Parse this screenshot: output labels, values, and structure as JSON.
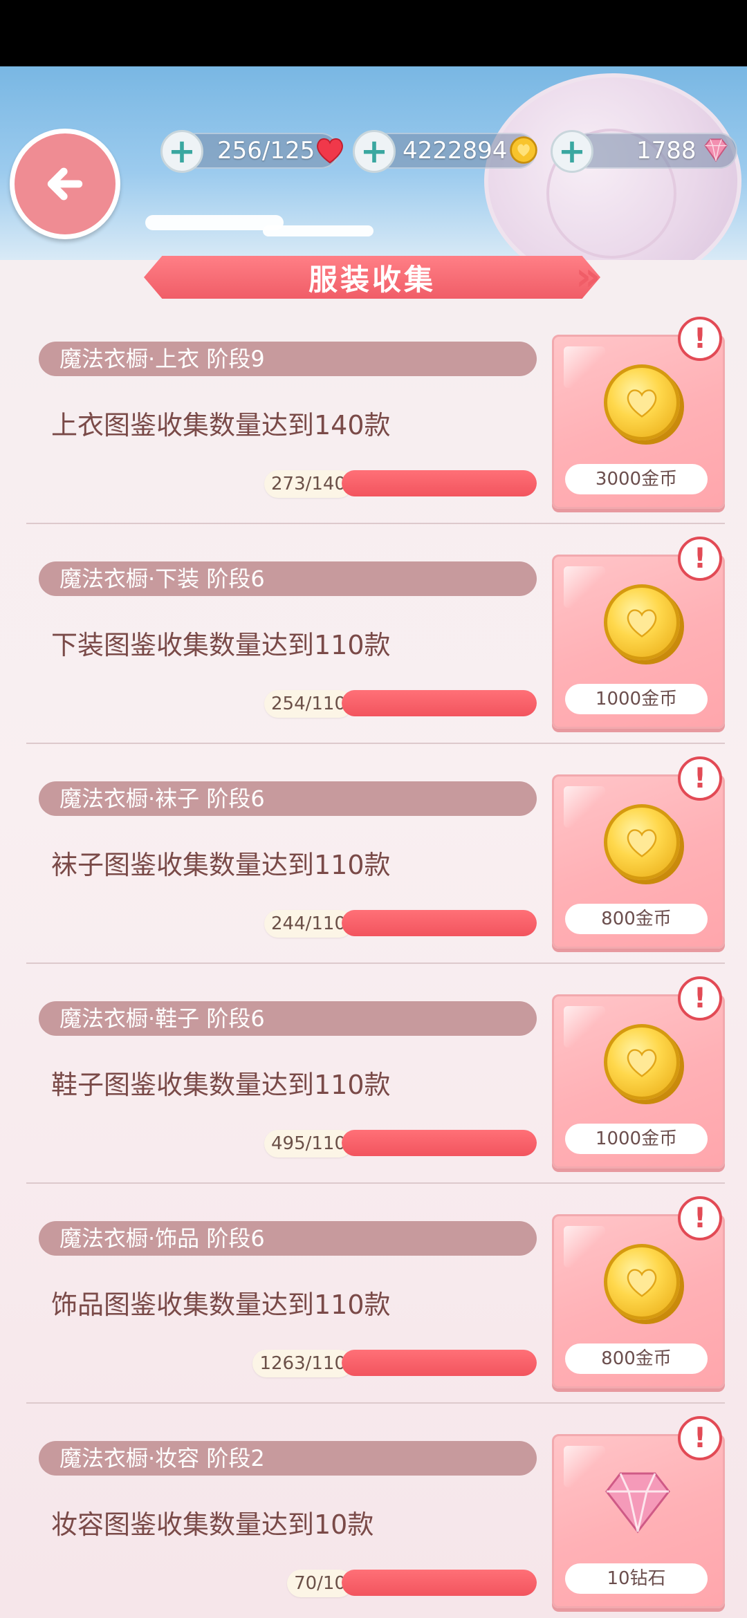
{
  "header": {
    "title": "服装收集",
    "back_icon": "back-arrow-icon"
  },
  "resources": {
    "stamina": "256/125",
    "gold": "4222894",
    "diamonds": "1788"
  },
  "tasks": [
    {
      "title": "魔法衣橱·上衣 阶段9",
      "desc": "上衣图鉴收集数量达到140款",
      "progress_text": "273/140",
      "progress": 1.0,
      "reward": "3000金币",
      "reward_icon": "gold-coin-icon"
    },
    {
      "title": "魔法衣橱·下装 阶段6",
      "desc": "下装图鉴收集数量达到110款",
      "progress_text": "254/110",
      "progress": 1.0,
      "reward": "1000金币",
      "reward_icon": "gold-coin-icon"
    },
    {
      "title": "魔法衣橱·袜子 阶段6",
      "desc": "袜子图鉴收集数量达到110款",
      "progress_text": "244/110",
      "progress": 1.0,
      "reward": "800金币",
      "reward_icon": "gold-coin-icon"
    },
    {
      "title": "魔法衣橱·鞋子 阶段6",
      "desc": "鞋子图鉴收集数量达到110款",
      "progress_text": "495/110",
      "progress": 1.0,
      "reward": "1000金币",
      "reward_icon": "gold-coin-icon"
    },
    {
      "title": "魔法衣橱·饰品 阶段6",
      "desc": "饰品图鉴收集数量达到110款",
      "progress_text": "1263/110",
      "progress": 1.0,
      "reward": "800金币",
      "reward_icon": "gold-coin-icon"
    },
    {
      "title": "魔法衣橱·妆容 阶段2",
      "desc": "妆容图鉴收集数量达到10款",
      "progress_text": "70/10",
      "progress": 1.0,
      "reward": "10钻石",
      "reward_icon": "diamond-icon"
    }
  ],
  "colors": {
    "accent": "#f05d67",
    "header_pill": "#c79a9d",
    "text": "#7a4a48"
  }
}
